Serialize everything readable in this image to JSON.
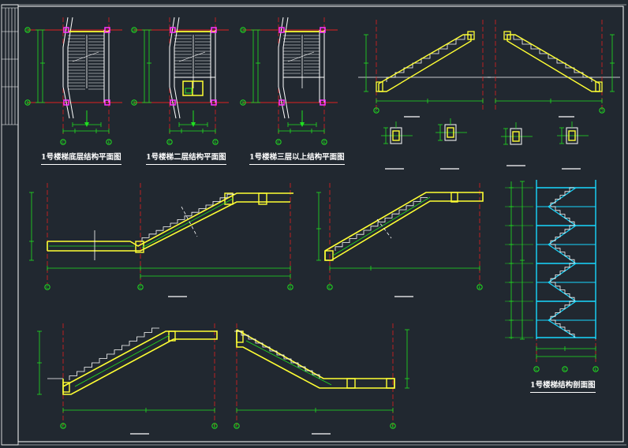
{
  "drawing": {
    "background": "#212830",
    "colors": {
      "frame": "#ffffff",
      "axis": "#e02020",
      "dim": "#20e020",
      "beam": "#ffff33",
      "stair": "#ffffff",
      "column": "#ff33ff",
      "section_bg": "#18d8ff",
      "bubble": "#20e020"
    },
    "captions": {
      "plan_ground": "1号楼梯底层结构平面图",
      "plan_second": "1号楼梯二层结构平面图",
      "plan_third": "1号楼梯三层以上结构平面图",
      "section": "1号楼梯结构剖面图"
    },
    "grid_labels": {
      "rows": [
        "D",
        "B"
      ],
      "cols": [
        "C",
        "E"
      ]
    }
  }
}
